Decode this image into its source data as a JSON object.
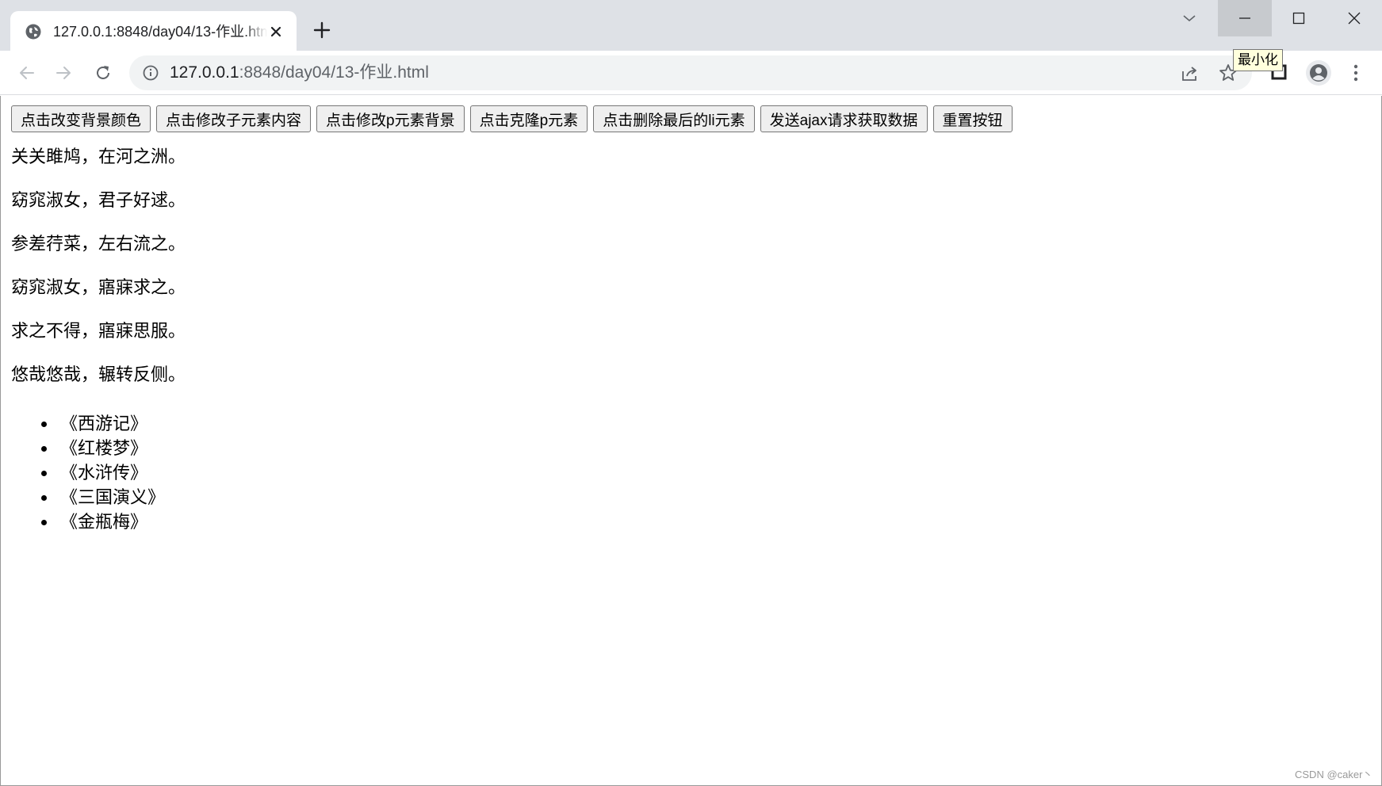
{
  "browser": {
    "tab": {
      "title": "127.0.0.1:8848/day04/13-作业.html"
    },
    "address": {
      "host": "127.0.0.1",
      "path": ":8848/day04/13-作业.html"
    },
    "tooltip": "最小化"
  },
  "page": {
    "buttons": [
      "点击改变背景颜色",
      "点击修改子元素内容",
      "点击修改p元素背景",
      "点击克隆p元素",
      "点击删除最后的li元素",
      "发送ajax请求获取数据",
      "重置按钮"
    ],
    "poem": [
      "关关雎鸠，在河之洲。",
      "窈窕淑女，君子好逑。",
      "参差荇菜，左右流之。",
      "窈窕淑女，寤寐求之。",
      "求之不得，寤寐思服。",
      "悠哉悠哉，辗转反侧。"
    ],
    "books": [
      "《西游记》",
      "《红楼梦》",
      "《水浒传》",
      "《三国演义》",
      "《金瓶梅》"
    ]
  },
  "watermark": "CSDN @caker丶"
}
